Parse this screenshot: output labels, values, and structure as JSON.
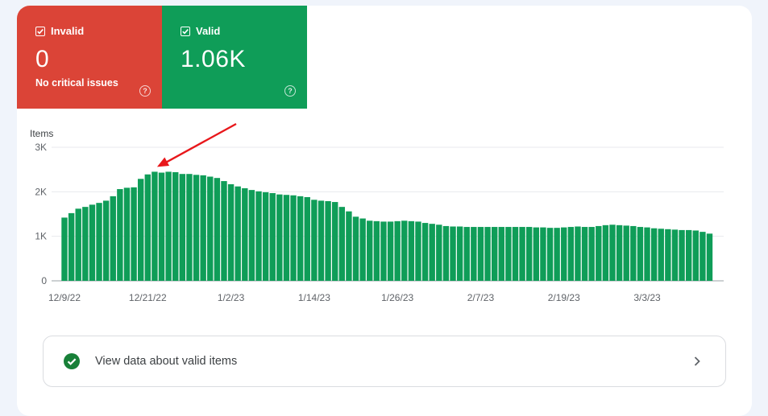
{
  "tiles": {
    "invalid": {
      "label": "Invalid",
      "value": "0",
      "sub": "No critical issues",
      "help": "?",
      "color": "#db4437"
    },
    "valid": {
      "label": "Valid",
      "value": "1.06K",
      "help": "?",
      "color": "#0f9d58"
    }
  },
  "link": {
    "label": "View data about valid items"
  },
  "chart_data": {
    "type": "bar",
    "ylabel": "Items",
    "ylim": [
      0,
      3000
    ],
    "yticks": [
      {
        "value": 0,
        "label": "0"
      },
      {
        "value": 1000,
        "label": "1K"
      },
      {
        "value": 2000,
        "label": "2K"
      },
      {
        "value": 3000,
        "label": "3K"
      }
    ],
    "xticks": [
      {
        "index": 0,
        "label": "12/9/22"
      },
      {
        "index": 12,
        "label": "12/21/22"
      },
      {
        "index": 24,
        "label": "1/2/23"
      },
      {
        "index": 36,
        "label": "1/14/23"
      },
      {
        "index": 48,
        "label": "1/26/23"
      },
      {
        "index": 60,
        "label": "2/7/23"
      },
      {
        "index": 72,
        "label": "2/19/23"
      },
      {
        "index": 84,
        "label": "3/3/23"
      }
    ],
    "bar_color": "#0f9d58",
    "grid": true,
    "annotation": {
      "type": "arrow",
      "color": "#e8171b",
      "target_index": 13
    },
    "values": [
      1420,
      1520,
      1620,
      1660,
      1710,
      1750,
      1800,
      1900,
      2060,
      2090,
      2100,
      2290,
      2390,
      2450,
      2430,
      2450,
      2440,
      2400,
      2400,
      2380,
      2370,
      2340,
      2310,
      2240,
      2170,
      2120,
      2080,
      2040,
      2010,
      1990,
      1970,
      1940,
      1930,
      1920,
      1900,
      1880,
      1820,
      1800,
      1790,
      1770,
      1660,
      1560,
      1440,
      1400,
      1350,
      1340,
      1330,
      1330,
      1340,
      1350,
      1340,
      1330,
      1300,
      1280,
      1260,
      1230,
      1220,
      1220,
      1210,
      1210,
      1210,
      1210,
      1210,
      1210,
      1210,
      1210,
      1210,
      1210,
      1200,
      1200,
      1190,
      1190,
      1200,
      1210,
      1220,
      1210,
      1210,
      1230,
      1250,
      1260,
      1250,
      1240,
      1230,
      1210,
      1200,
      1180,
      1170,
      1160,
      1150,
      1140,
      1140,
      1130,
      1100,
      1060
    ]
  }
}
